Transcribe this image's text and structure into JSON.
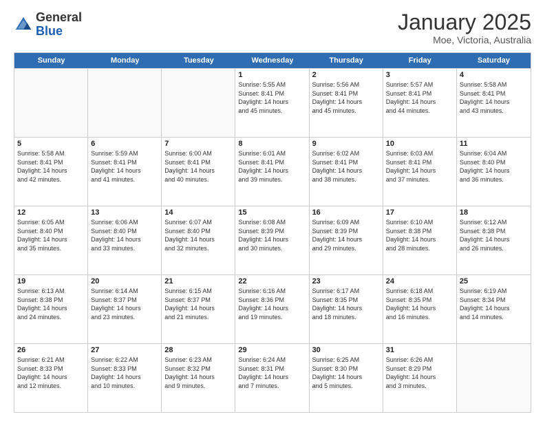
{
  "header": {
    "logo_general": "General",
    "logo_blue": "Blue",
    "title": "January 2025",
    "subtitle": "Moe, Victoria, Australia"
  },
  "days_of_week": [
    "Sunday",
    "Monday",
    "Tuesday",
    "Wednesday",
    "Thursday",
    "Friday",
    "Saturday"
  ],
  "weeks": [
    [
      {
        "day": "",
        "info": ""
      },
      {
        "day": "",
        "info": ""
      },
      {
        "day": "",
        "info": ""
      },
      {
        "day": "1",
        "info": "Sunrise: 5:55 AM\nSunset: 8:41 PM\nDaylight: 14 hours\nand 45 minutes."
      },
      {
        "day": "2",
        "info": "Sunrise: 5:56 AM\nSunset: 8:41 PM\nDaylight: 14 hours\nand 45 minutes."
      },
      {
        "day": "3",
        "info": "Sunrise: 5:57 AM\nSunset: 8:41 PM\nDaylight: 14 hours\nand 44 minutes."
      },
      {
        "day": "4",
        "info": "Sunrise: 5:58 AM\nSunset: 8:41 PM\nDaylight: 14 hours\nand 43 minutes."
      }
    ],
    [
      {
        "day": "5",
        "info": "Sunrise: 5:58 AM\nSunset: 8:41 PM\nDaylight: 14 hours\nand 42 minutes."
      },
      {
        "day": "6",
        "info": "Sunrise: 5:59 AM\nSunset: 8:41 PM\nDaylight: 14 hours\nand 41 minutes."
      },
      {
        "day": "7",
        "info": "Sunrise: 6:00 AM\nSunset: 8:41 PM\nDaylight: 14 hours\nand 40 minutes."
      },
      {
        "day": "8",
        "info": "Sunrise: 6:01 AM\nSunset: 8:41 PM\nDaylight: 14 hours\nand 39 minutes."
      },
      {
        "day": "9",
        "info": "Sunrise: 6:02 AM\nSunset: 8:41 PM\nDaylight: 14 hours\nand 38 minutes."
      },
      {
        "day": "10",
        "info": "Sunrise: 6:03 AM\nSunset: 8:41 PM\nDaylight: 14 hours\nand 37 minutes."
      },
      {
        "day": "11",
        "info": "Sunrise: 6:04 AM\nSunset: 8:40 PM\nDaylight: 14 hours\nand 36 minutes."
      }
    ],
    [
      {
        "day": "12",
        "info": "Sunrise: 6:05 AM\nSunset: 8:40 PM\nDaylight: 14 hours\nand 35 minutes."
      },
      {
        "day": "13",
        "info": "Sunrise: 6:06 AM\nSunset: 8:40 PM\nDaylight: 14 hours\nand 33 minutes."
      },
      {
        "day": "14",
        "info": "Sunrise: 6:07 AM\nSunset: 8:40 PM\nDaylight: 14 hours\nand 32 minutes."
      },
      {
        "day": "15",
        "info": "Sunrise: 6:08 AM\nSunset: 8:39 PM\nDaylight: 14 hours\nand 30 minutes."
      },
      {
        "day": "16",
        "info": "Sunrise: 6:09 AM\nSunset: 8:39 PM\nDaylight: 14 hours\nand 29 minutes."
      },
      {
        "day": "17",
        "info": "Sunrise: 6:10 AM\nSunset: 8:38 PM\nDaylight: 14 hours\nand 28 minutes."
      },
      {
        "day": "18",
        "info": "Sunrise: 6:12 AM\nSunset: 8:38 PM\nDaylight: 14 hours\nand 26 minutes."
      }
    ],
    [
      {
        "day": "19",
        "info": "Sunrise: 6:13 AM\nSunset: 8:38 PM\nDaylight: 14 hours\nand 24 minutes."
      },
      {
        "day": "20",
        "info": "Sunrise: 6:14 AM\nSunset: 8:37 PM\nDaylight: 14 hours\nand 23 minutes."
      },
      {
        "day": "21",
        "info": "Sunrise: 6:15 AM\nSunset: 8:37 PM\nDaylight: 14 hours\nand 21 minutes."
      },
      {
        "day": "22",
        "info": "Sunrise: 6:16 AM\nSunset: 8:36 PM\nDaylight: 14 hours\nand 19 minutes."
      },
      {
        "day": "23",
        "info": "Sunrise: 6:17 AM\nSunset: 8:35 PM\nDaylight: 14 hours\nand 18 minutes."
      },
      {
        "day": "24",
        "info": "Sunrise: 6:18 AM\nSunset: 8:35 PM\nDaylight: 14 hours\nand 16 minutes."
      },
      {
        "day": "25",
        "info": "Sunrise: 6:19 AM\nSunset: 8:34 PM\nDaylight: 14 hours\nand 14 minutes."
      }
    ],
    [
      {
        "day": "26",
        "info": "Sunrise: 6:21 AM\nSunset: 8:33 PM\nDaylight: 14 hours\nand 12 minutes."
      },
      {
        "day": "27",
        "info": "Sunrise: 6:22 AM\nSunset: 8:33 PM\nDaylight: 14 hours\nand 10 minutes."
      },
      {
        "day": "28",
        "info": "Sunrise: 6:23 AM\nSunset: 8:32 PM\nDaylight: 14 hours\nand 9 minutes."
      },
      {
        "day": "29",
        "info": "Sunrise: 6:24 AM\nSunset: 8:31 PM\nDaylight: 14 hours\nand 7 minutes."
      },
      {
        "day": "30",
        "info": "Sunrise: 6:25 AM\nSunset: 8:30 PM\nDaylight: 14 hours\nand 5 minutes."
      },
      {
        "day": "31",
        "info": "Sunrise: 6:26 AM\nSunset: 8:29 PM\nDaylight: 14 hours\nand 3 minutes."
      },
      {
        "day": "",
        "info": ""
      }
    ]
  ]
}
